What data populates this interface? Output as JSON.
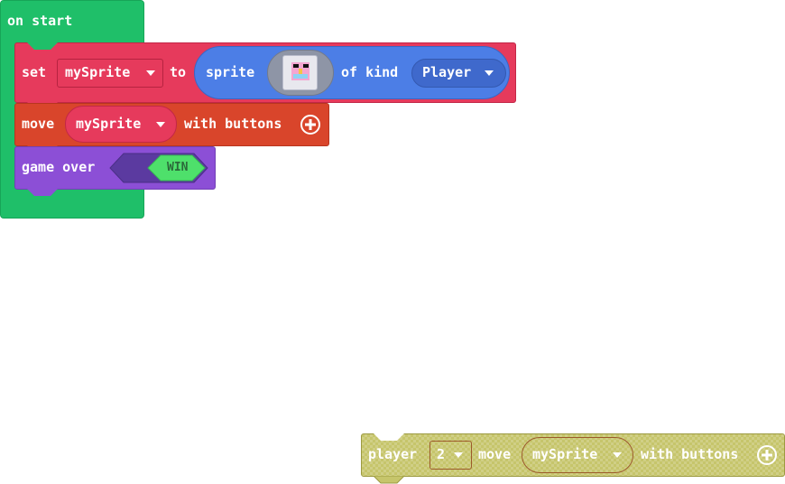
{
  "workspace": {
    "on_start": {
      "label": "on start",
      "set_block": {
        "set_label": "set",
        "variable": "mySprite",
        "to_label": "to",
        "sprite_label": "sprite",
        "of_kind_label": "of kind",
        "kind": "Player"
      },
      "move_block": {
        "move_label": "move",
        "variable": "mySprite",
        "with_buttons_label": "with buttons"
      },
      "game_over_block": {
        "label": "game over",
        "result": "WIN"
      }
    },
    "detached_block": {
      "player_label": "player",
      "player_number": "2",
      "move_label": "move",
      "variable": "mySprite",
      "with_buttons_label": "with buttons"
    }
  },
  "colors": {
    "event_green": "#1fbf69",
    "variables_red": "#e63a5c",
    "controller_orange": "#d9452b",
    "sprites_blue": "#4c7ee6",
    "info_purple": "#8c4fd6",
    "disabled_olive": "#c6c56b"
  }
}
